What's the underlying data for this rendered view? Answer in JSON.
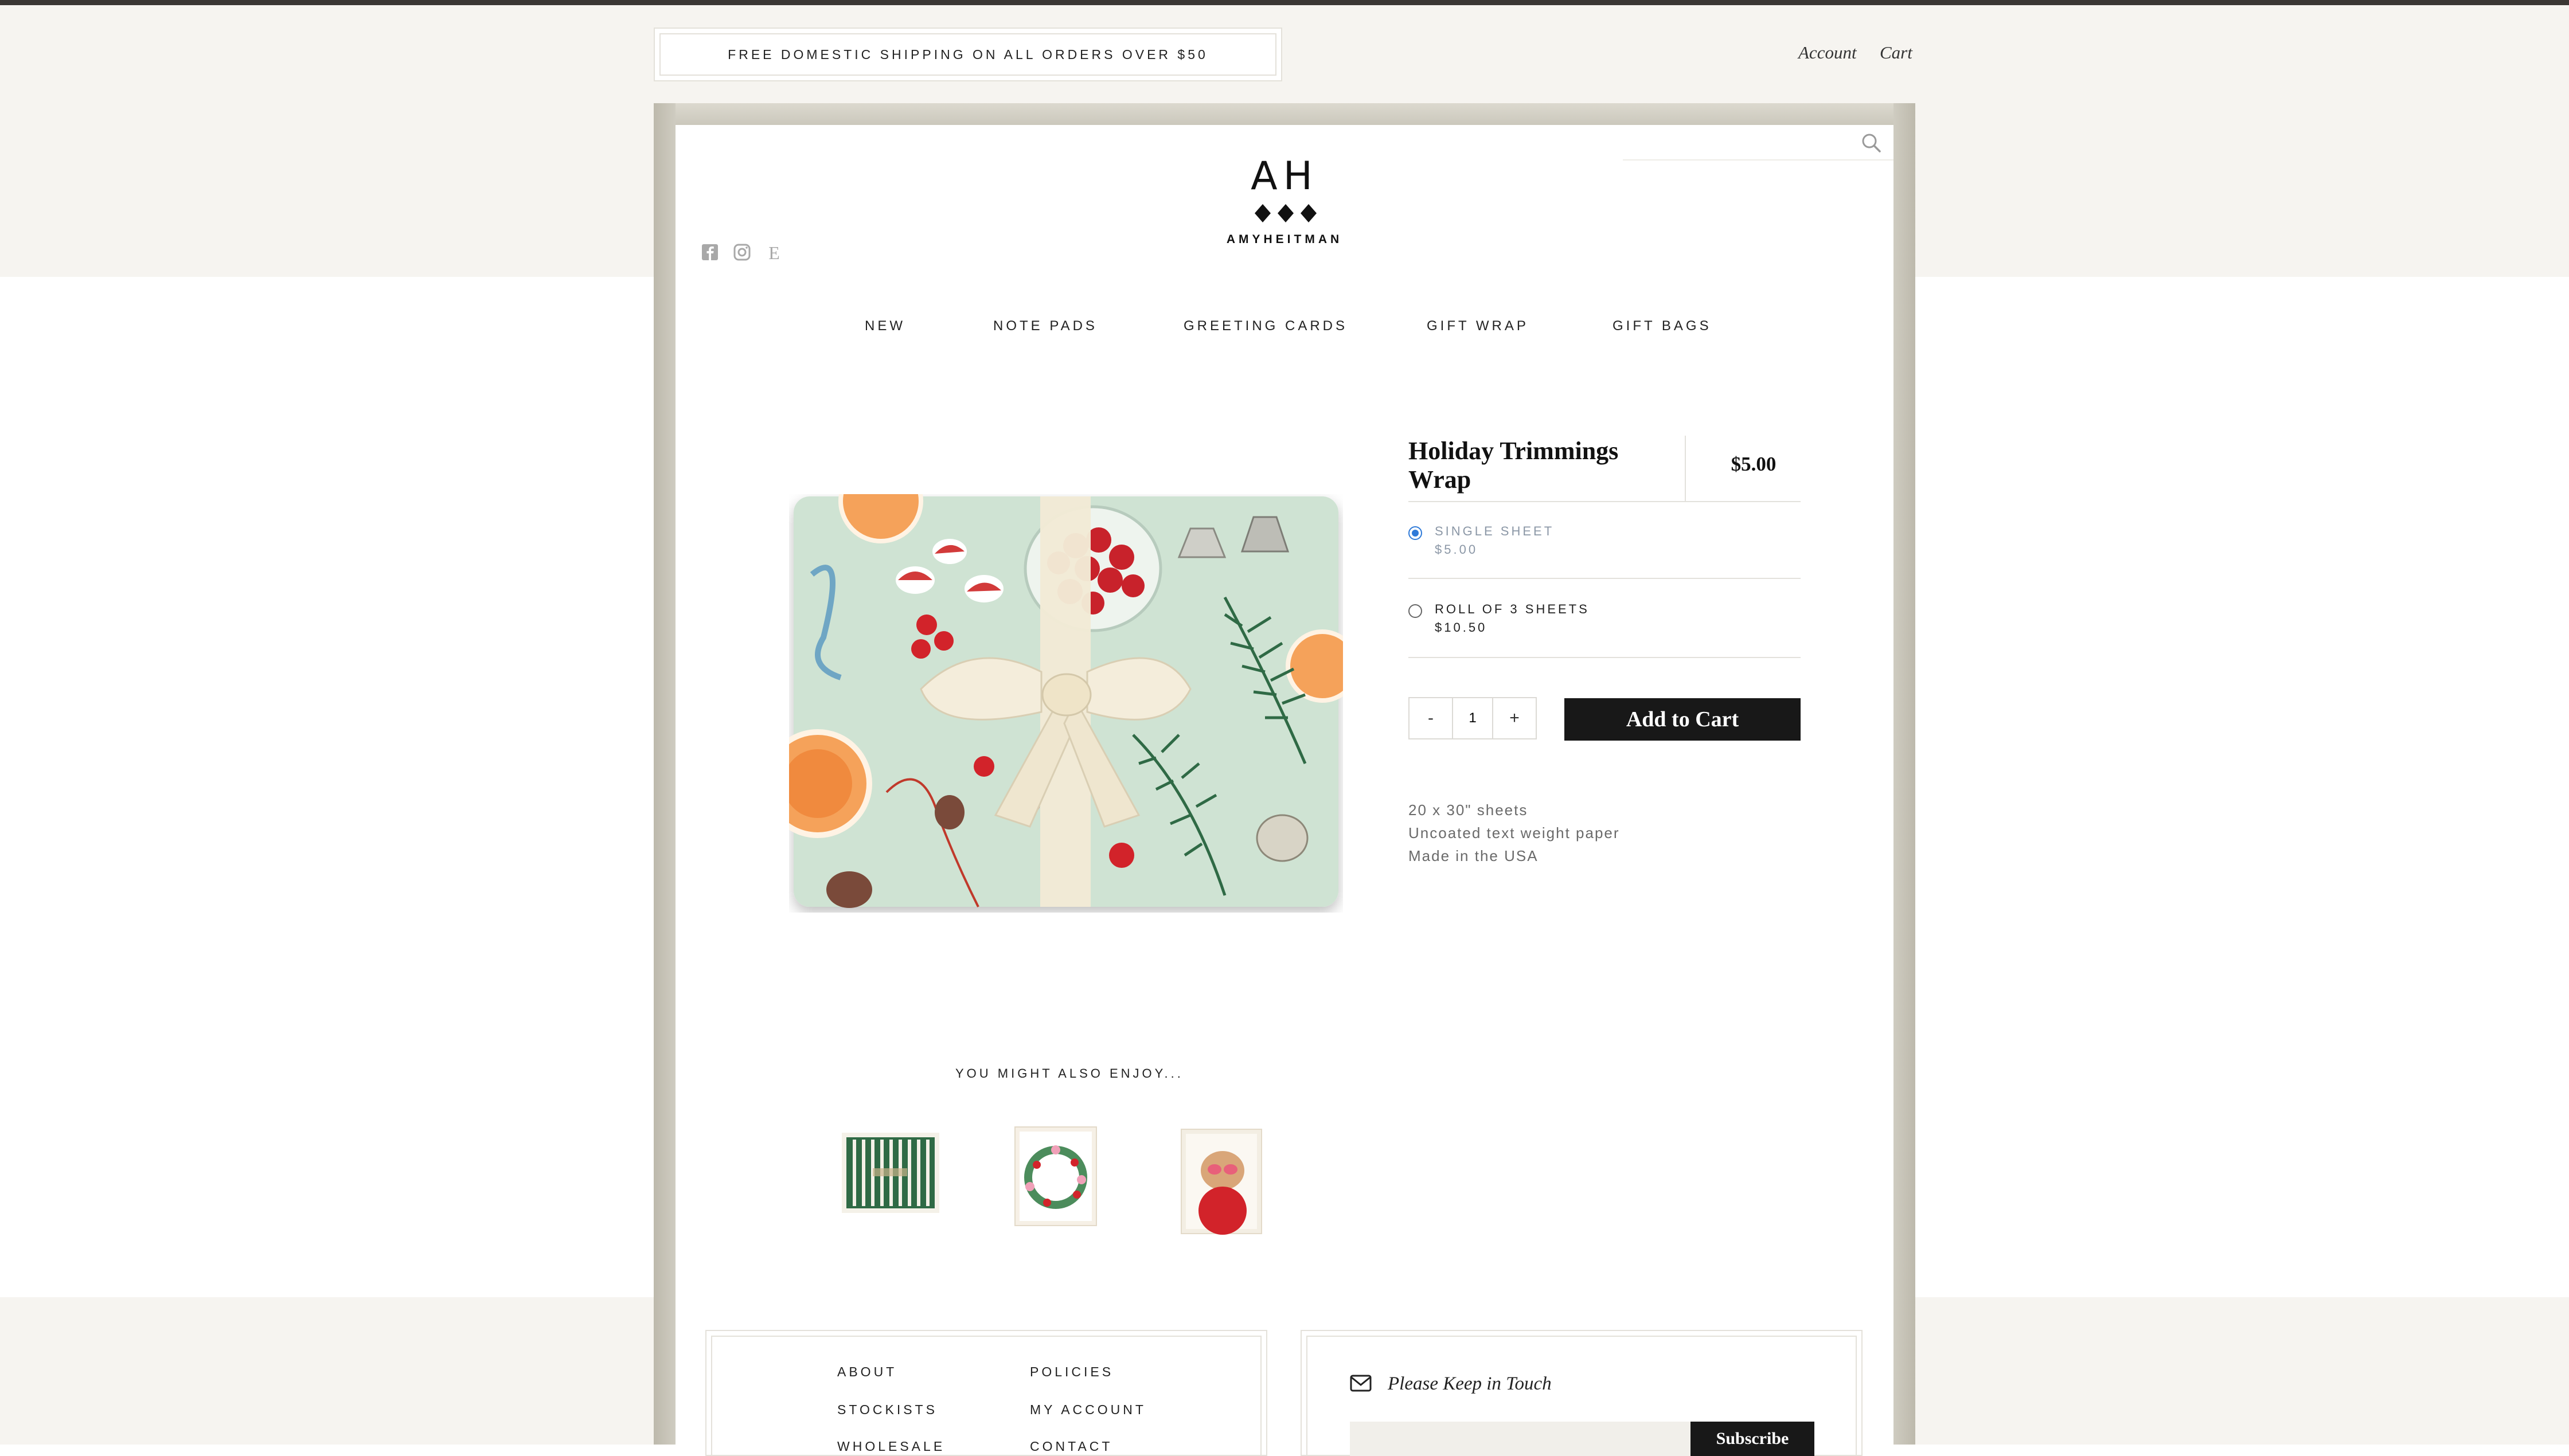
{
  "banner": {
    "shipping_text": "FREE DOMESTIC SHIPPING ON ALL ORDERS OVER $50"
  },
  "header": {
    "account_label": "Account",
    "cart_label": "Cart",
    "logo_monogram": "AH",
    "logo_name": "AMYHEITMAN",
    "search_placeholder": "",
    "social_icons": [
      "facebook-icon",
      "instagram-icon",
      "etsy-icon"
    ]
  },
  "nav": {
    "items": [
      "NEW",
      "NOTE PADS",
      "GREETING CARDS",
      "GIFT WRAP",
      "GIFT BAGS"
    ]
  },
  "product": {
    "title": "Holiday Trimmings Wrap",
    "price": "$5.00",
    "options": [
      {
        "name": "SINGLE SHEET",
        "price": "$5.00",
        "selected": true
      },
      {
        "name": "ROLL OF 3 SHEETS",
        "price": "$10.50",
        "selected": false
      }
    ],
    "quantity": "1",
    "minus_label": "-",
    "plus_label": "+",
    "add_to_cart_label": "Add to Cart",
    "details": [
      "20 x 30\" sheets",
      "Uncoated text weight paper",
      "Made in the USA"
    ]
  },
  "related": {
    "heading": "YOU MIGHT ALSO ENJOY..."
  },
  "footer": {
    "links_col1": [
      "ABOUT",
      "STOCKISTS",
      "WHOLESALE"
    ],
    "links_col2": [
      "POLICIES",
      "MY ACCOUNT",
      "CONTACT"
    ],
    "newsletter_title": "Please Keep in Touch",
    "subscribe_label": "Subscribe"
  },
  "colors": {
    "page_bg": "#f6f4f0",
    "frame": "#c8c5b9",
    "button": "#181818",
    "radio_selected": "#2f7ad8",
    "wrap_paper": "#cfe3d3"
  }
}
